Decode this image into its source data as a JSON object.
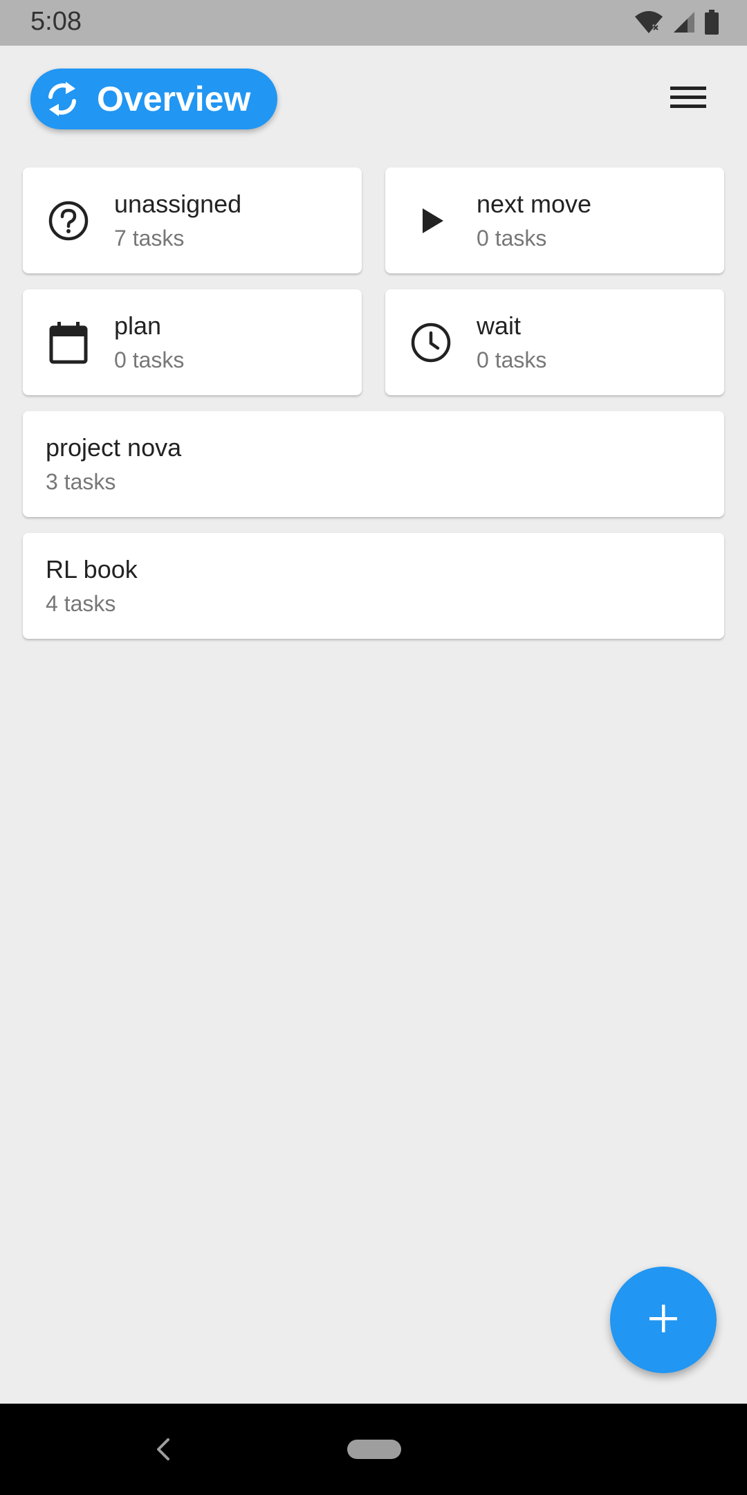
{
  "status_bar": {
    "time": "5:08",
    "icons": [
      "wifi-icon",
      "cellular-signal-icon",
      "battery-icon"
    ]
  },
  "header": {
    "title": "Overview",
    "title_icon": "sync-icon",
    "menu_icon": "hamburger-menu-icon"
  },
  "categories": [
    {
      "icon": "help-circle-icon",
      "title": "unassigned",
      "count": "7 tasks"
    },
    {
      "icon": "play-icon",
      "title": "next move",
      "count": "0 tasks"
    },
    {
      "icon": "calendar-icon",
      "title": "plan",
      "count": "0 tasks"
    },
    {
      "icon": "clock-icon",
      "title": "wait",
      "count": "0 tasks"
    }
  ],
  "projects": [
    {
      "title": "project nova",
      "count": "3 tasks"
    },
    {
      "title": "RL book",
      "count": "4 tasks"
    }
  ],
  "fab": {
    "icon": "plus-icon"
  },
  "colors": {
    "accent": "#2196f3",
    "background": "#ededed",
    "card": "#ffffff",
    "status_bar": "#b3b3b3",
    "nav_bar": "#000000"
  }
}
